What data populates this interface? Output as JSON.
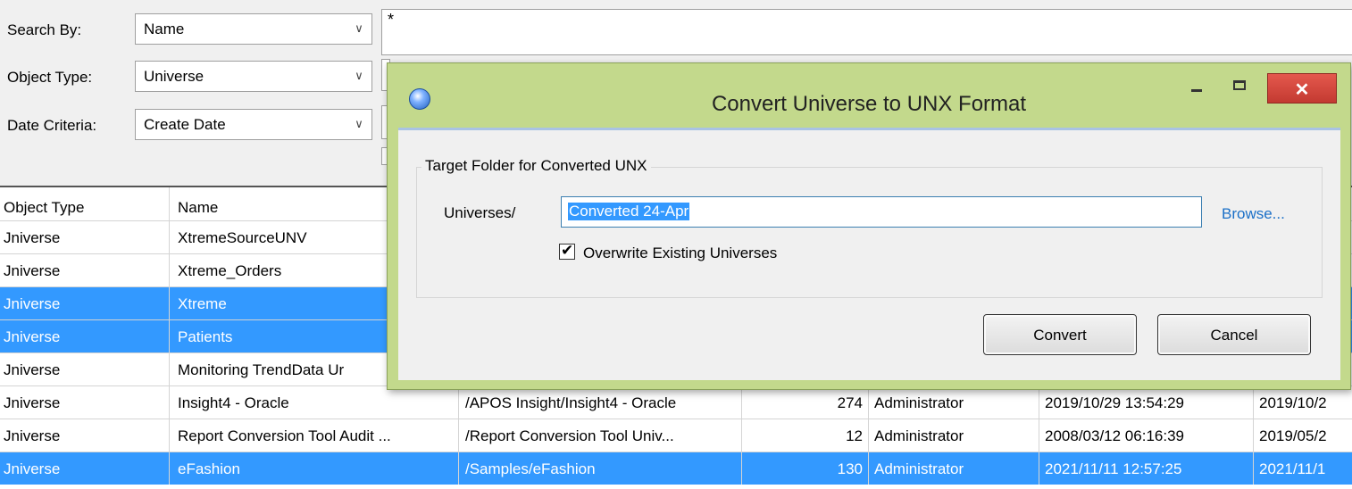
{
  "search_panel": {
    "search_by_label": "Search By:",
    "search_by_value": "Name",
    "object_type_label": "Object Type:",
    "object_type_value": "Universe",
    "date_criteria_label": "Date Criteria:",
    "date_criteria_value": "Create Date",
    "search_text": "*"
  },
  "grid": {
    "columns": [
      "Object Type",
      "Name",
      "",
      "",
      "",
      "",
      ""
    ],
    "rows": [
      {
        "type": "Jniverse",
        "name": "XtremeSourceUNV",
        "path": "",
        "size": "",
        "owner": "",
        "created": "",
        "modified": "",
        "selected": false
      },
      {
        "type": "Jniverse",
        "name": "Xtreme_Orders",
        "path": "",
        "size": "",
        "owner": "",
        "created": "",
        "modified": "",
        "selected": false
      },
      {
        "type": "Jniverse",
        "name": "Xtreme",
        "path": "",
        "size": "",
        "owner": "",
        "created": "",
        "modified": "",
        "selected": true
      },
      {
        "type": "Jniverse",
        "name": "Patients",
        "path": "",
        "size": "",
        "owner": "",
        "created": "",
        "modified": "",
        "selected": true
      },
      {
        "type": "Jniverse",
        "name": "Monitoring TrendData Ur",
        "path": "",
        "size": "",
        "owner": "",
        "created": "",
        "modified": "",
        "selected": false
      },
      {
        "type": "Jniverse",
        "name": "Insight4 - Oracle",
        "path": "/APOS Insight/Insight4 - Oracle",
        "size": "274",
        "owner": "Administrator",
        "created": "2019/10/29 13:54:29",
        "modified": "2019/10/2",
        "selected": false
      },
      {
        "type": "Jniverse",
        "name": "Report Conversion Tool Audit ...",
        "path": "/Report Conversion Tool Univ...",
        "size": "12",
        "owner": "Administrator",
        "created": "2008/03/12 06:16:39",
        "modified": "2019/05/2",
        "selected": false
      },
      {
        "type": "Jniverse",
        "name": "eFashion",
        "path": "/Samples/eFashion",
        "size": "130",
        "owner": "Administrator",
        "created": "2021/11/11 12:57:25",
        "modified": "2021/11/1",
        "selected": true
      }
    ]
  },
  "dialog": {
    "title": "Convert Universe to UNX Format",
    "close_glyph": "✕",
    "group_label": "Target Folder for Converted UNX",
    "folder_prefix": "Universes/",
    "folder_name": "Converted 24-Apr",
    "browse_label": "Browse...",
    "overwrite_label": "Overwrite Existing Universes",
    "overwrite_checked": true,
    "check_glyph": "✔",
    "convert_label": "Convert",
    "cancel_label": "Cancel"
  },
  "colors": {
    "selection": "#3399ff",
    "dialog_frame": "#c3d98c",
    "close_button": "#d4473d",
    "link": "#1a6fc7"
  },
  "icons": [
    "dropdown-arrow-icon",
    "app-globe-icon",
    "minimize-icon",
    "maximize-icon",
    "close-icon",
    "checkmark-icon"
  ]
}
